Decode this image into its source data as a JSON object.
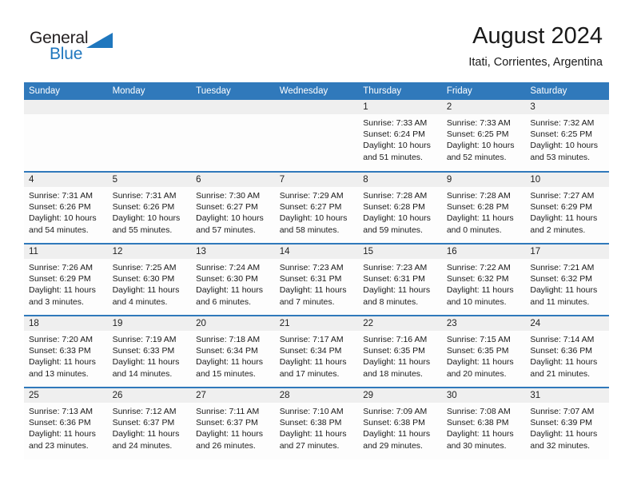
{
  "brand": {
    "name_part1": "General",
    "name_part2": "Blue",
    "accent_color": "#1f77be"
  },
  "header": {
    "title": "August 2024",
    "subtitle": "Itati, Corrientes, Argentina"
  },
  "theme": {
    "header_row_color": "#3079bb",
    "daynum_band_color": "#efefef",
    "cell_background": "#fdfdfd"
  },
  "weekday_headers": [
    "Sunday",
    "Monday",
    "Tuesday",
    "Wednesday",
    "Thursday",
    "Friday",
    "Saturday"
  ],
  "weeks": [
    [
      {
        "day": "",
        "sunrise": "",
        "sunset": "",
        "daylight1": "",
        "daylight2": ""
      },
      {
        "day": "",
        "sunrise": "",
        "sunset": "",
        "daylight1": "",
        "daylight2": ""
      },
      {
        "day": "",
        "sunrise": "",
        "sunset": "",
        "daylight1": "",
        "daylight2": ""
      },
      {
        "day": "",
        "sunrise": "",
        "sunset": "",
        "daylight1": "",
        "daylight2": ""
      },
      {
        "day": "1",
        "sunrise": "Sunrise: 7:33 AM",
        "sunset": "Sunset: 6:24 PM",
        "daylight1": "Daylight: 10 hours",
        "daylight2": "and 51 minutes."
      },
      {
        "day": "2",
        "sunrise": "Sunrise: 7:33 AM",
        "sunset": "Sunset: 6:25 PM",
        "daylight1": "Daylight: 10 hours",
        "daylight2": "and 52 minutes."
      },
      {
        "day": "3",
        "sunrise": "Sunrise: 7:32 AM",
        "sunset": "Sunset: 6:25 PM",
        "daylight1": "Daylight: 10 hours",
        "daylight2": "and 53 minutes."
      }
    ],
    [
      {
        "day": "4",
        "sunrise": "Sunrise: 7:31 AM",
        "sunset": "Sunset: 6:26 PM",
        "daylight1": "Daylight: 10 hours",
        "daylight2": "and 54 minutes."
      },
      {
        "day": "5",
        "sunrise": "Sunrise: 7:31 AM",
        "sunset": "Sunset: 6:26 PM",
        "daylight1": "Daylight: 10 hours",
        "daylight2": "and 55 minutes."
      },
      {
        "day": "6",
        "sunrise": "Sunrise: 7:30 AM",
        "sunset": "Sunset: 6:27 PM",
        "daylight1": "Daylight: 10 hours",
        "daylight2": "and 57 minutes."
      },
      {
        "day": "7",
        "sunrise": "Sunrise: 7:29 AM",
        "sunset": "Sunset: 6:27 PM",
        "daylight1": "Daylight: 10 hours",
        "daylight2": "and 58 minutes."
      },
      {
        "day": "8",
        "sunrise": "Sunrise: 7:28 AM",
        "sunset": "Sunset: 6:28 PM",
        "daylight1": "Daylight: 10 hours",
        "daylight2": "and 59 minutes."
      },
      {
        "day": "9",
        "sunrise": "Sunrise: 7:28 AM",
        "sunset": "Sunset: 6:28 PM",
        "daylight1": "Daylight: 11 hours",
        "daylight2": "and 0 minutes."
      },
      {
        "day": "10",
        "sunrise": "Sunrise: 7:27 AM",
        "sunset": "Sunset: 6:29 PM",
        "daylight1": "Daylight: 11 hours",
        "daylight2": "and 2 minutes."
      }
    ],
    [
      {
        "day": "11",
        "sunrise": "Sunrise: 7:26 AM",
        "sunset": "Sunset: 6:29 PM",
        "daylight1": "Daylight: 11 hours",
        "daylight2": "and 3 minutes."
      },
      {
        "day": "12",
        "sunrise": "Sunrise: 7:25 AM",
        "sunset": "Sunset: 6:30 PM",
        "daylight1": "Daylight: 11 hours",
        "daylight2": "and 4 minutes."
      },
      {
        "day": "13",
        "sunrise": "Sunrise: 7:24 AM",
        "sunset": "Sunset: 6:30 PM",
        "daylight1": "Daylight: 11 hours",
        "daylight2": "and 6 minutes."
      },
      {
        "day": "14",
        "sunrise": "Sunrise: 7:23 AM",
        "sunset": "Sunset: 6:31 PM",
        "daylight1": "Daylight: 11 hours",
        "daylight2": "and 7 minutes."
      },
      {
        "day": "15",
        "sunrise": "Sunrise: 7:23 AM",
        "sunset": "Sunset: 6:31 PM",
        "daylight1": "Daylight: 11 hours",
        "daylight2": "and 8 minutes."
      },
      {
        "day": "16",
        "sunrise": "Sunrise: 7:22 AM",
        "sunset": "Sunset: 6:32 PM",
        "daylight1": "Daylight: 11 hours",
        "daylight2": "and 10 minutes."
      },
      {
        "day": "17",
        "sunrise": "Sunrise: 7:21 AM",
        "sunset": "Sunset: 6:32 PM",
        "daylight1": "Daylight: 11 hours",
        "daylight2": "and 11 minutes."
      }
    ],
    [
      {
        "day": "18",
        "sunrise": "Sunrise: 7:20 AM",
        "sunset": "Sunset: 6:33 PM",
        "daylight1": "Daylight: 11 hours",
        "daylight2": "and 13 minutes."
      },
      {
        "day": "19",
        "sunrise": "Sunrise: 7:19 AM",
        "sunset": "Sunset: 6:33 PM",
        "daylight1": "Daylight: 11 hours",
        "daylight2": "and 14 minutes."
      },
      {
        "day": "20",
        "sunrise": "Sunrise: 7:18 AM",
        "sunset": "Sunset: 6:34 PM",
        "daylight1": "Daylight: 11 hours",
        "daylight2": "and 15 minutes."
      },
      {
        "day": "21",
        "sunrise": "Sunrise: 7:17 AM",
        "sunset": "Sunset: 6:34 PM",
        "daylight1": "Daylight: 11 hours",
        "daylight2": "and 17 minutes."
      },
      {
        "day": "22",
        "sunrise": "Sunrise: 7:16 AM",
        "sunset": "Sunset: 6:35 PM",
        "daylight1": "Daylight: 11 hours",
        "daylight2": "and 18 minutes."
      },
      {
        "day": "23",
        "sunrise": "Sunrise: 7:15 AM",
        "sunset": "Sunset: 6:35 PM",
        "daylight1": "Daylight: 11 hours",
        "daylight2": "and 20 minutes."
      },
      {
        "day": "24",
        "sunrise": "Sunrise: 7:14 AM",
        "sunset": "Sunset: 6:36 PM",
        "daylight1": "Daylight: 11 hours",
        "daylight2": "and 21 minutes."
      }
    ],
    [
      {
        "day": "25",
        "sunrise": "Sunrise: 7:13 AM",
        "sunset": "Sunset: 6:36 PM",
        "daylight1": "Daylight: 11 hours",
        "daylight2": "and 23 minutes."
      },
      {
        "day": "26",
        "sunrise": "Sunrise: 7:12 AM",
        "sunset": "Sunset: 6:37 PM",
        "daylight1": "Daylight: 11 hours",
        "daylight2": "and 24 minutes."
      },
      {
        "day": "27",
        "sunrise": "Sunrise: 7:11 AM",
        "sunset": "Sunset: 6:37 PM",
        "daylight1": "Daylight: 11 hours",
        "daylight2": "and 26 minutes."
      },
      {
        "day": "28",
        "sunrise": "Sunrise: 7:10 AM",
        "sunset": "Sunset: 6:38 PM",
        "daylight1": "Daylight: 11 hours",
        "daylight2": "and 27 minutes."
      },
      {
        "day": "29",
        "sunrise": "Sunrise: 7:09 AM",
        "sunset": "Sunset: 6:38 PM",
        "daylight1": "Daylight: 11 hours",
        "daylight2": "and 29 minutes."
      },
      {
        "day": "30",
        "sunrise": "Sunrise: 7:08 AM",
        "sunset": "Sunset: 6:38 PM",
        "daylight1": "Daylight: 11 hours",
        "daylight2": "and 30 minutes."
      },
      {
        "day": "31",
        "sunrise": "Sunrise: 7:07 AM",
        "sunset": "Sunset: 6:39 PM",
        "daylight1": "Daylight: 11 hours",
        "daylight2": "and 32 minutes."
      }
    ]
  ]
}
